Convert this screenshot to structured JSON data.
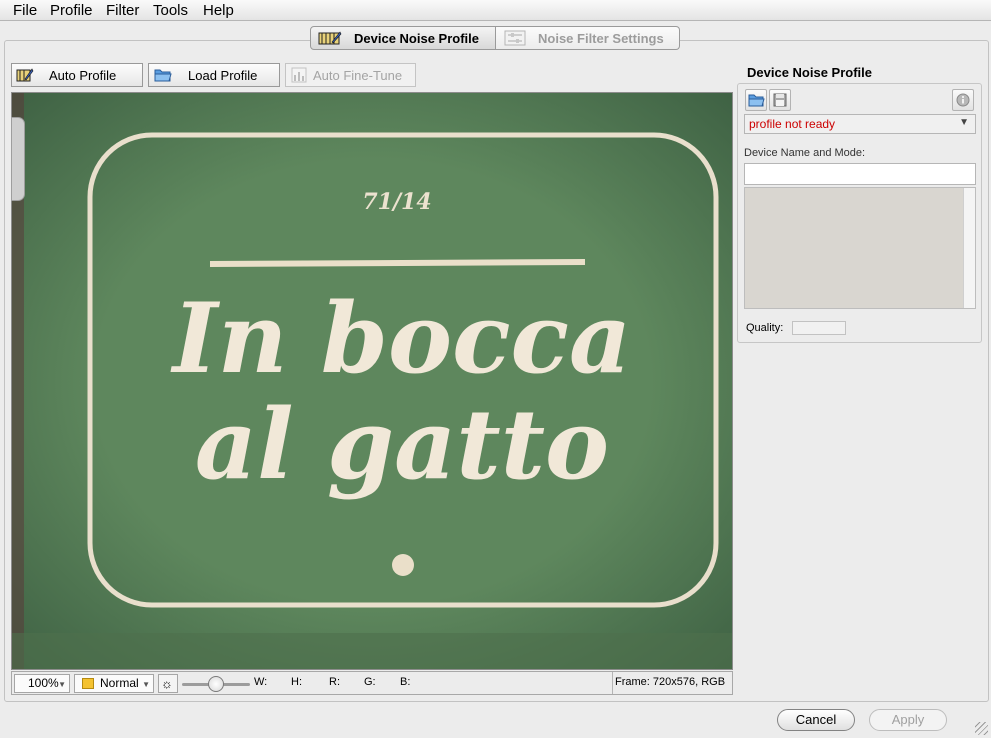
{
  "menu": [
    "File",
    "Profile",
    "Filter",
    "Tools",
    "Help"
  ],
  "tabs": {
    "device_noise_profile": "Device Noise Profile",
    "noise_filter_settings": "Noise Filter Settings"
  },
  "toolbar": {
    "auto_profile": "Auto Profile",
    "load_profile": "Load Profile",
    "auto_fine_tune": "Auto Fine-Tune"
  },
  "preview": {
    "fraction": "71/14",
    "title_line1": "In bocca",
    "title_line2": "al gatto"
  },
  "status": {
    "zoom": "100%",
    "mode": "Normal",
    "brightness_level": 0.5,
    "w_label": "W:",
    "h_label": "H:",
    "r_label": "R:",
    "g_label": "G:",
    "b_label": "B:",
    "frame_info": "Frame: 720x576, RGB"
  },
  "panel": {
    "title": "Device Noise Profile",
    "profile_status": "profile not ready",
    "device_name_label": "Device Name and Mode:",
    "device_name_value": "",
    "quality_label": "Quality:"
  },
  "buttons": {
    "cancel": "Cancel",
    "apply": "Apply"
  },
  "colors": {
    "status_error": "#cc0000",
    "preview_background": "#59825a",
    "card_text": "#f1e8d8"
  }
}
